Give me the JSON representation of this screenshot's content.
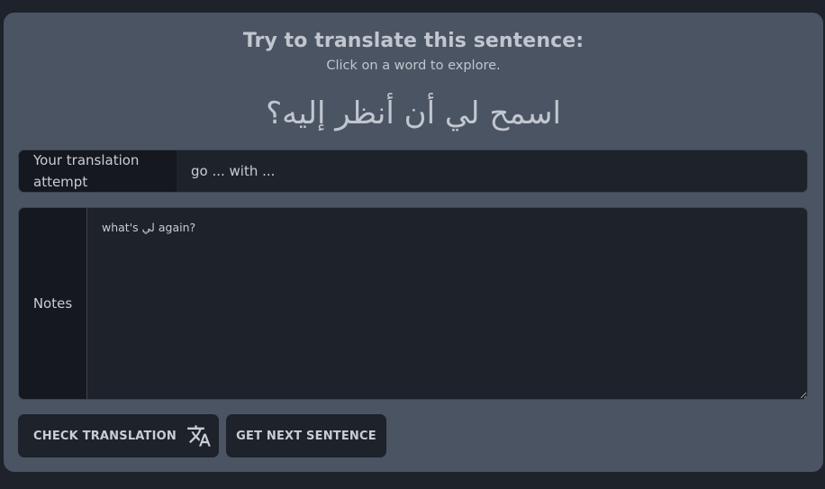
{
  "header": {
    "title": "Try to translate this sentence:",
    "subtitle": "Click on a word to explore."
  },
  "sentence": {
    "words": [
      "اسمح",
      "لي",
      "أن",
      "أنظر",
      "إليه؟"
    ]
  },
  "attempt": {
    "label": "Your translation attempt",
    "value": "go ... with ..."
  },
  "notes": {
    "label": "Notes",
    "value": "what's لي again?"
  },
  "actions": {
    "check_label": "CHECK TRANSLATION",
    "next_label": "GET NEXT SENTENCE"
  },
  "icons": {
    "check": "translate-icon"
  },
  "colors": {
    "page_background": "#1d222b",
    "card_background": "#4b5463",
    "input_background": "#1d222b",
    "label_background": "#15181e",
    "text": "#c9cdd4"
  }
}
